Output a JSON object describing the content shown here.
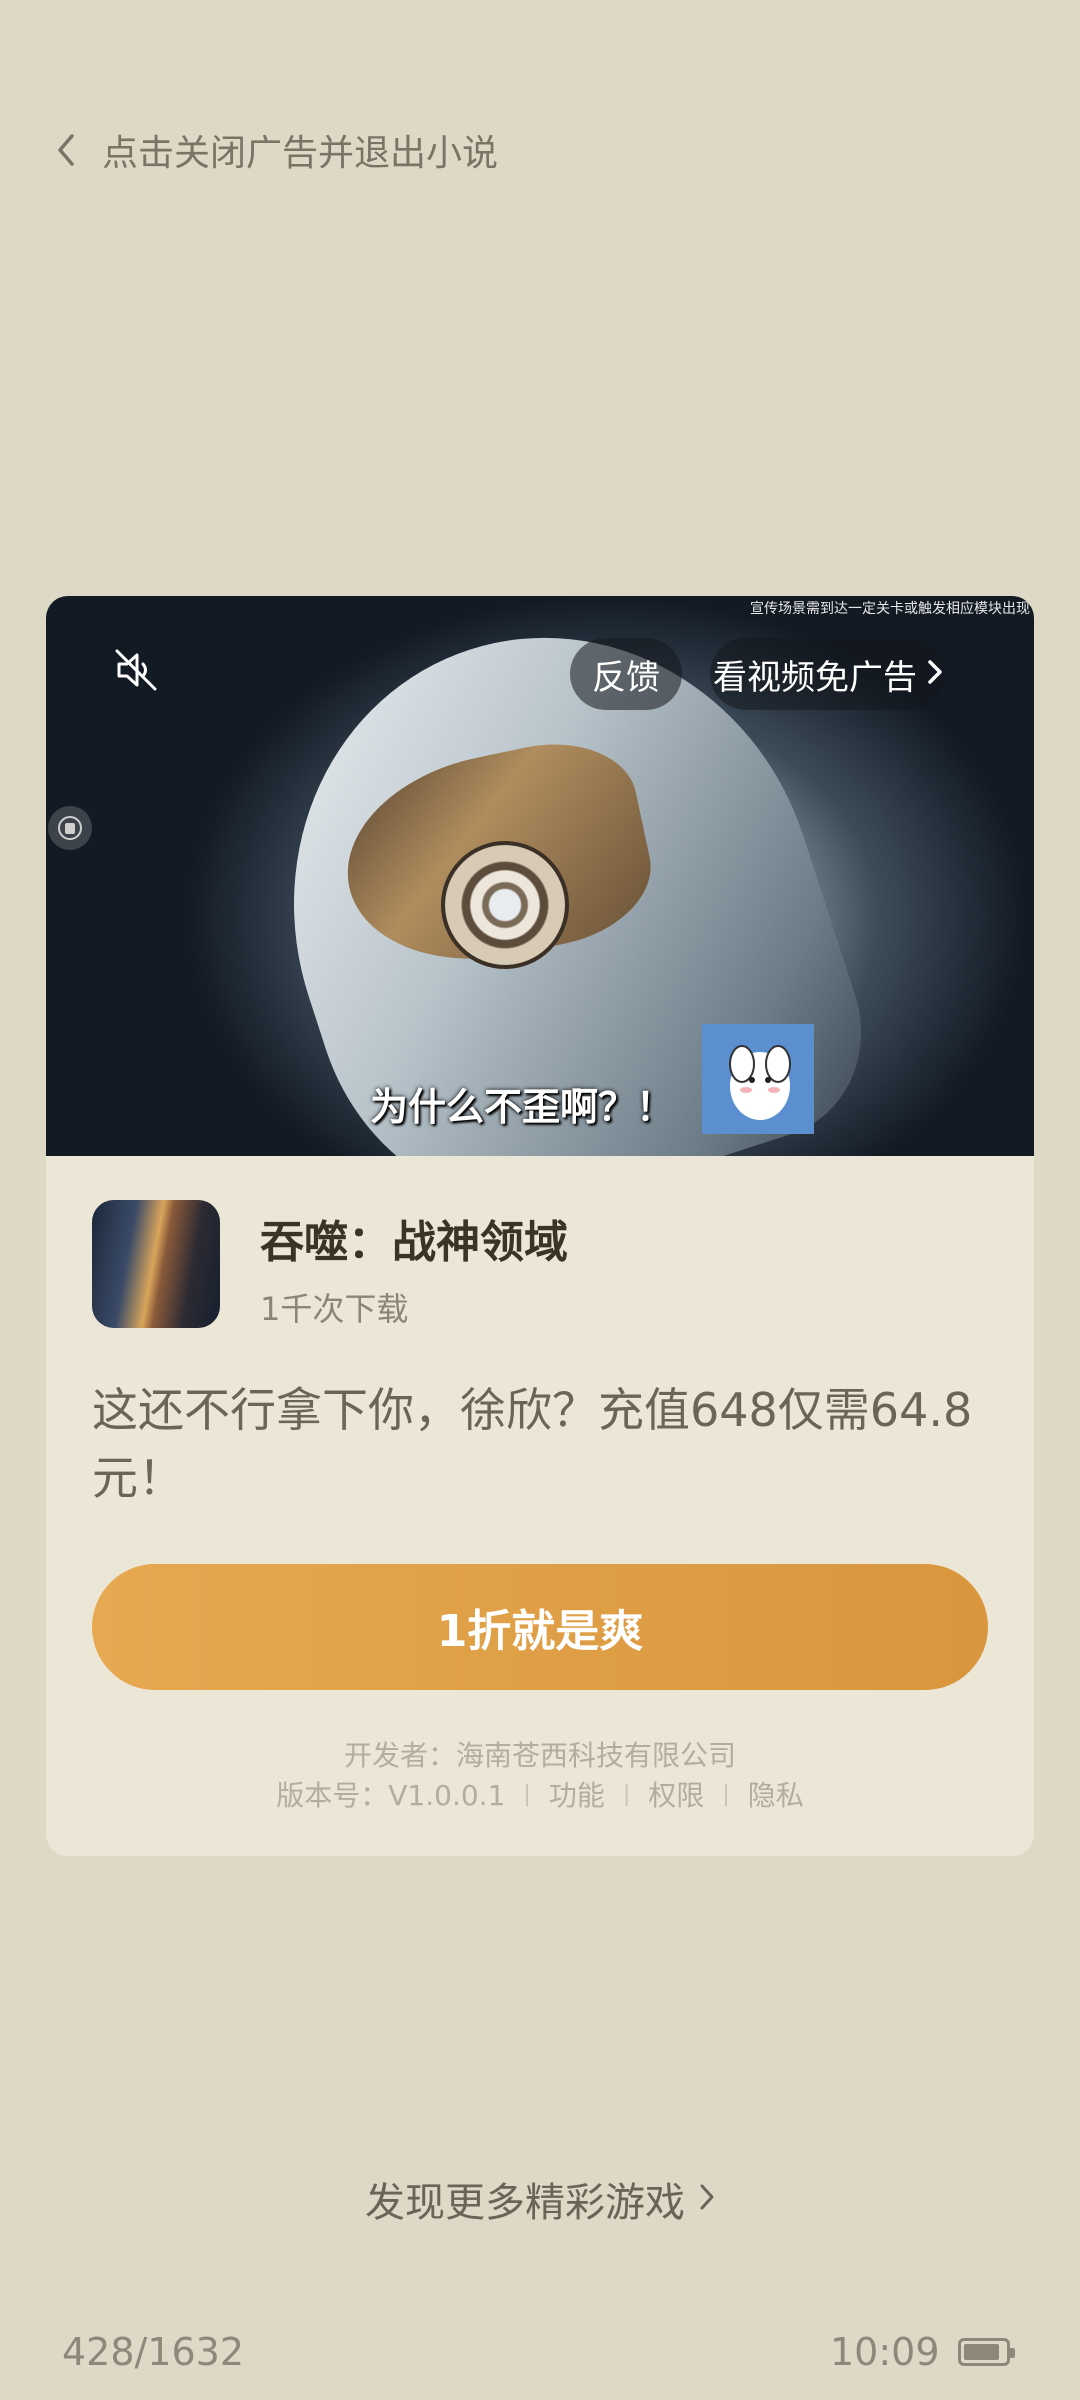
{
  "topbar": {
    "close_text": "点击关闭广告并退出小说"
  },
  "ad": {
    "video": {
      "top_note": "宣传场景需到达一定关卡或触发相应模块出现",
      "feedback_label": "反馈",
      "skip_label": "看视频免广告",
      "subtitle": "为什么不歪啊？！"
    },
    "app_name": "吞噬：战神领域",
    "downloads": "1千次下载",
    "description": "这还不行拿下你，徐欣？充值648仅需64.8元！",
    "cta_label": "1折就是爽",
    "developer": "开发者：海南苍西科技有限公司",
    "version": "版本号：V1.0.0.1",
    "links": {
      "features": "功能",
      "permissions": "权限",
      "privacy": "隐私"
    },
    "colors": {
      "cta": "#E0A048",
      "card": "#ECE6D7"
    }
  },
  "more_games": "发现更多精彩游戏",
  "status": {
    "progress": "428/1632",
    "time": "10:09",
    "battery_level": 0.9
  },
  "icons": [
    "back-chevron-icon",
    "mute-icon",
    "chevron-right-icon",
    "battery-icon"
  ]
}
